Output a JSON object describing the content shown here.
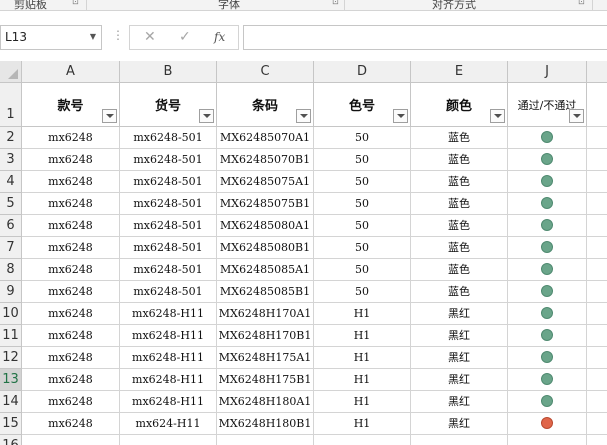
{
  "ribbon": {
    "groups": [
      {
        "label": "剪贴板"
      },
      {
        "label": "字体"
      },
      {
        "label": "对齐方式"
      }
    ],
    "launcher_glyph": "⊡"
  },
  "formula_bar": {
    "name_box": "L13",
    "name_box_arrow": "▼",
    "dots": "⋮",
    "cancel_glyph": "✕",
    "enter_glyph": "✓",
    "fx_label": "fx",
    "formula_value": ""
  },
  "sheet": {
    "columns": [
      "A",
      "B",
      "C",
      "D",
      "E",
      "J"
    ],
    "headers": [
      "款号",
      "货号",
      "条码",
      "色号",
      "颜色",
      "通过/不通过"
    ],
    "header_row_label": "1",
    "selected_row": "13",
    "rows": [
      {
        "row": "2",
        "cells": [
          "mx6248",
          "mx6248-501",
          "MX62485070A1",
          "50",
          "蓝色"
        ],
        "status": "pass"
      },
      {
        "row": "3",
        "cells": [
          "mx6248",
          "mx6248-501",
          "MX62485070B1",
          "50",
          "蓝色"
        ],
        "status": "pass"
      },
      {
        "row": "4",
        "cells": [
          "mx6248",
          "mx6248-501",
          "MX62485075A1",
          "50",
          "蓝色"
        ],
        "status": "pass"
      },
      {
        "row": "5",
        "cells": [
          "mx6248",
          "mx6248-501",
          "MX62485075B1",
          "50",
          "蓝色"
        ],
        "status": "pass"
      },
      {
        "row": "6",
        "cells": [
          "mx6248",
          "mx6248-501",
          "MX62485080A1",
          "50",
          "蓝色"
        ],
        "status": "pass"
      },
      {
        "row": "7",
        "cells": [
          "mx6248",
          "mx6248-501",
          "MX62485080B1",
          "50",
          "蓝色"
        ],
        "status": "pass"
      },
      {
        "row": "8",
        "cells": [
          "mx6248",
          "mx6248-501",
          "MX62485085A1",
          "50",
          "蓝色"
        ],
        "status": "pass"
      },
      {
        "row": "9",
        "cells": [
          "mx6248",
          "mx6248-501",
          "MX62485085B1",
          "50",
          "蓝色"
        ],
        "status": "pass"
      },
      {
        "row": "10",
        "cells": [
          "mx6248",
          "mx6248-H11",
          "MX6248H170A1",
          "H1",
          "黑红"
        ],
        "status": "pass"
      },
      {
        "row": "11",
        "cells": [
          "mx6248",
          "mx6248-H11",
          "MX6248H170B1",
          "H1",
          "黑红"
        ],
        "status": "pass"
      },
      {
        "row": "12",
        "cells": [
          "mx6248",
          "mx6248-H11",
          "MX6248H175A1",
          "H1",
          "黑红"
        ],
        "status": "pass"
      },
      {
        "row": "13",
        "cells": [
          "mx6248",
          "mx6248-H11",
          "MX6248H175B1",
          "H1",
          "黑红"
        ],
        "status": "pass"
      },
      {
        "row": "14",
        "cells": [
          "mx6248",
          "mx6248-H11",
          "MX6248H180A1",
          "H1",
          "黑红"
        ],
        "status": "pass"
      },
      {
        "row": "15",
        "cells": [
          "mx6248",
          "mx624-H11",
          "MX6248H180B1",
          "H1",
          "黑红"
        ],
        "status": "fail"
      },
      {
        "row": "16",
        "cells": [
          "",
          "",
          "",
          "",
          ""
        ],
        "status": "pass"
      }
    ]
  },
  "colors": {
    "pass": "#6aa58a",
    "fail": "#e0664a",
    "pass_border": "#4f8a70",
    "fail_border": "#b94a30"
  }
}
